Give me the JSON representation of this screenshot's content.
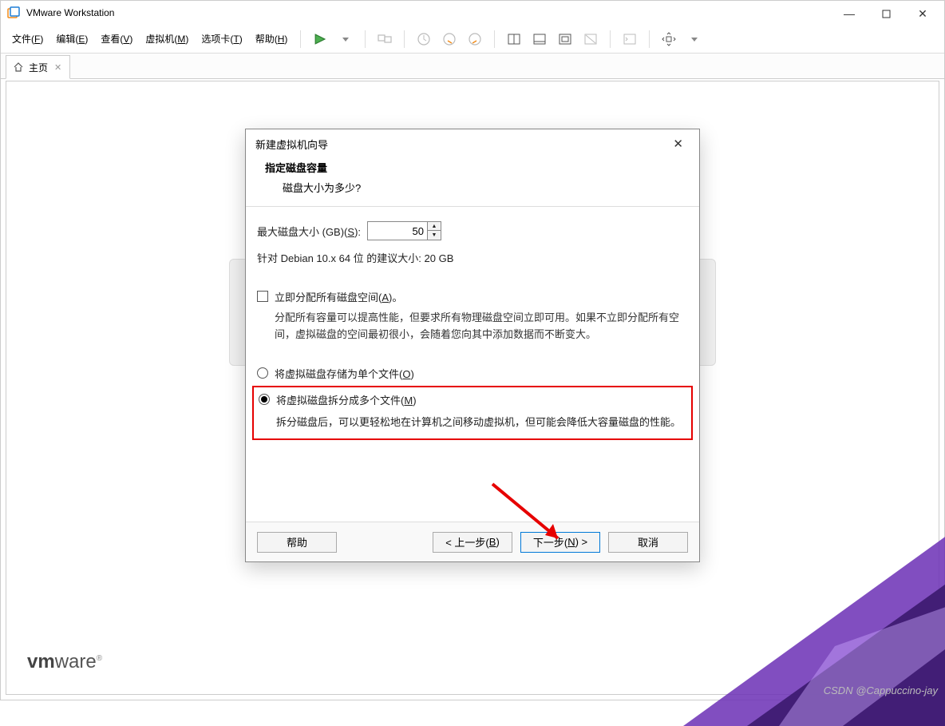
{
  "titlebar": {
    "app_name": "VMware Workstation"
  },
  "menubar": {
    "file": "文件(F)",
    "edit": "编辑(E)",
    "view": "查看(V)",
    "vm": "虚拟机(M)",
    "tabs": "选项卡(T)",
    "help": "帮助(H)"
  },
  "tabbar": {
    "home": "主页"
  },
  "wizard": {
    "title": "新建虚拟机向导",
    "heading": "指定磁盘容量",
    "question": "磁盘大小为多少?",
    "disk_label_pre": "最大磁盘大小 (GB)(",
    "disk_label_hot": "S",
    "disk_label_post": "):",
    "disk_value": "50",
    "recommend": "针对 Debian 10.x 64 位 的建议大小: 20 GB",
    "alloc_pre": "立即分配所有磁盘空间(",
    "alloc_hot": "A",
    "alloc_post": ")。",
    "alloc_desc": "分配所有容量可以提高性能，但要求所有物理磁盘空间立即可用。如果不立即分配所有空间，虚拟磁盘的空间最初很小，会随着您向其中添加数据而不断变大。",
    "single_pre": "将虚拟磁盘存储为单个文件(",
    "single_hot": "O",
    "single_post": ")",
    "split_pre": "将虚拟磁盘拆分成多个文件(",
    "split_hot": "M",
    "split_post": ")",
    "split_desc": "拆分磁盘后，可以更轻松地在计算机之间移动虚拟机，但可能会降低大容量磁盘的性能。",
    "help": "帮助",
    "back_pre": "< 上一步(",
    "back_hot": "B",
    "back_post": ")",
    "next_pre": "下一步(",
    "next_hot": "N",
    "next_post": ") >",
    "cancel": "取消"
  },
  "watermark": "CSDN @Cappuccino-jay"
}
